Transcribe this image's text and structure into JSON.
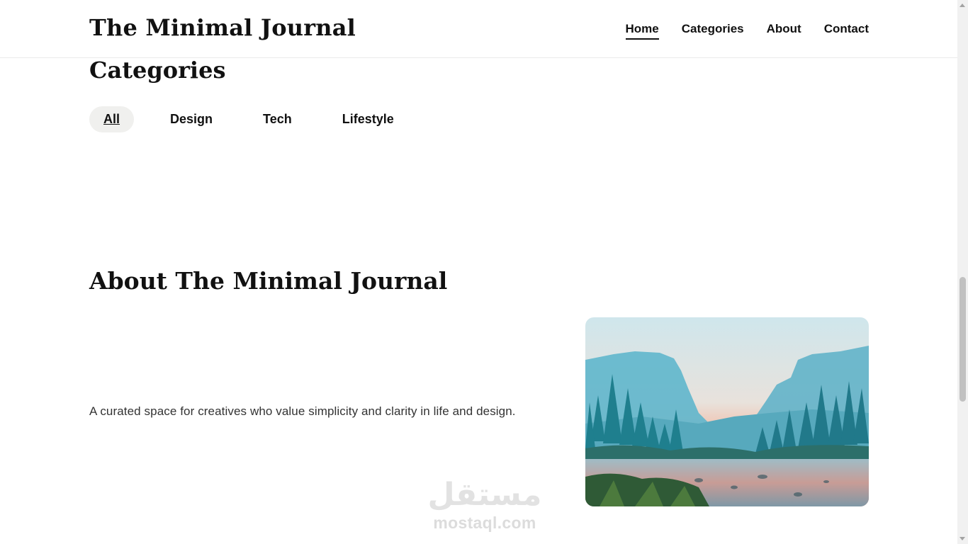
{
  "header": {
    "site_title": "The Minimal Journal",
    "nav": [
      {
        "label": "Home",
        "active": true
      },
      {
        "label": "Categories",
        "active": false
      },
      {
        "label": "About",
        "active": false
      },
      {
        "label": "Contact",
        "active": false
      }
    ]
  },
  "categories": {
    "title": "Categories",
    "filters": [
      {
        "label": "All",
        "active": true
      },
      {
        "label": "Design",
        "active": false
      },
      {
        "label": "Tech",
        "active": false
      },
      {
        "label": "Lifestyle",
        "active": false
      }
    ]
  },
  "about": {
    "title": "About The Minimal Journal",
    "text": "A curated space for creatives who value simplicity and clarity in life and design.",
    "image": "mountain-lake-landscape"
  },
  "watermark": {
    "arabic": "مستقل",
    "latin": "mostaql.com"
  }
}
